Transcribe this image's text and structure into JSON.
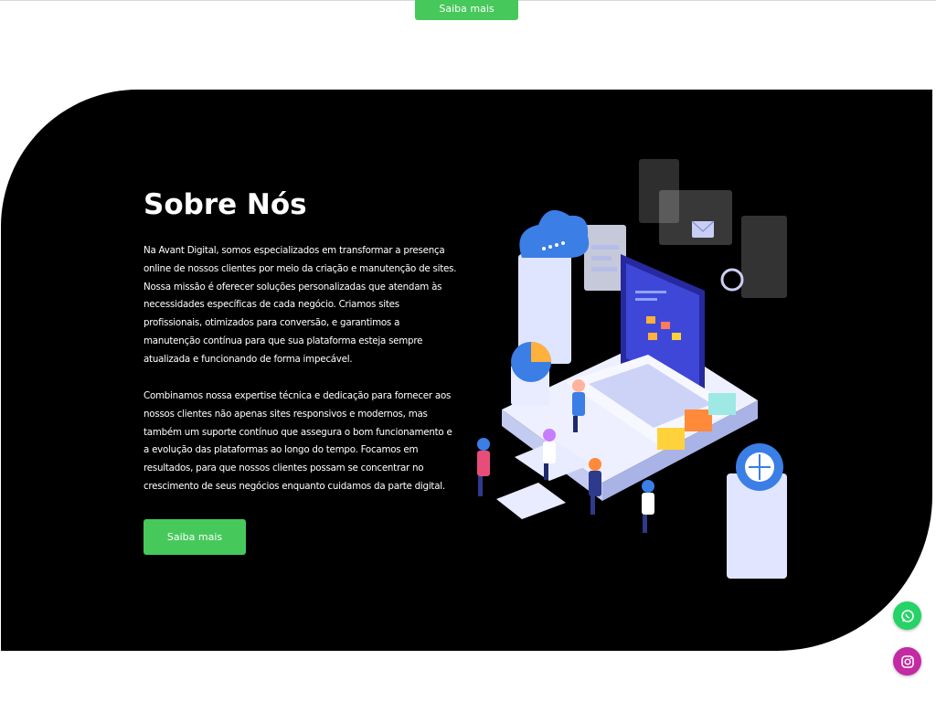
{
  "top": {
    "button_label": "Saiba mais"
  },
  "about": {
    "title": "Sobre Nós",
    "paragraph1": "Na Avant Digital, somos especializados em transformar a presença online de nossos clientes por meio da criação e manutenção de sites. Nossa missão é oferecer soluções personalizadas que atendam às necessidades específicas de cada negócio. Criamos sites profissionais, otimizados para conversão, e garantimos a manutenção contínua para que sua plataforma esteja sempre atualizada e funcionando de forma impecável.",
    "paragraph2": "Combinamos nossa expertise técnica e dedicação para fornecer aos nossos clientes não apenas sites responsivos e modernos, mas também um suporte contínuo que assegura o bom funcionamento e a evolução das plataformas ao longo do tempo. Focamos em resultados, para que nossos clientes possam se concentrar no crescimento de seus negócios enquanto cuidamos da parte digital.",
    "button_label": "Saiba mais",
    "illustration_icon": "isometric-web-development-illustration"
  },
  "floating": {
    "whatsapp_icon": "whatsapp-icon",
    "instagram_icon": "instagram-icon"
  },
  "colors": {
    "accent": "#46c95a",
    "section_bg": "#000000",
    "whatsapp": "#25d366",
    "instagram": "#c32aa3"
  }
}
